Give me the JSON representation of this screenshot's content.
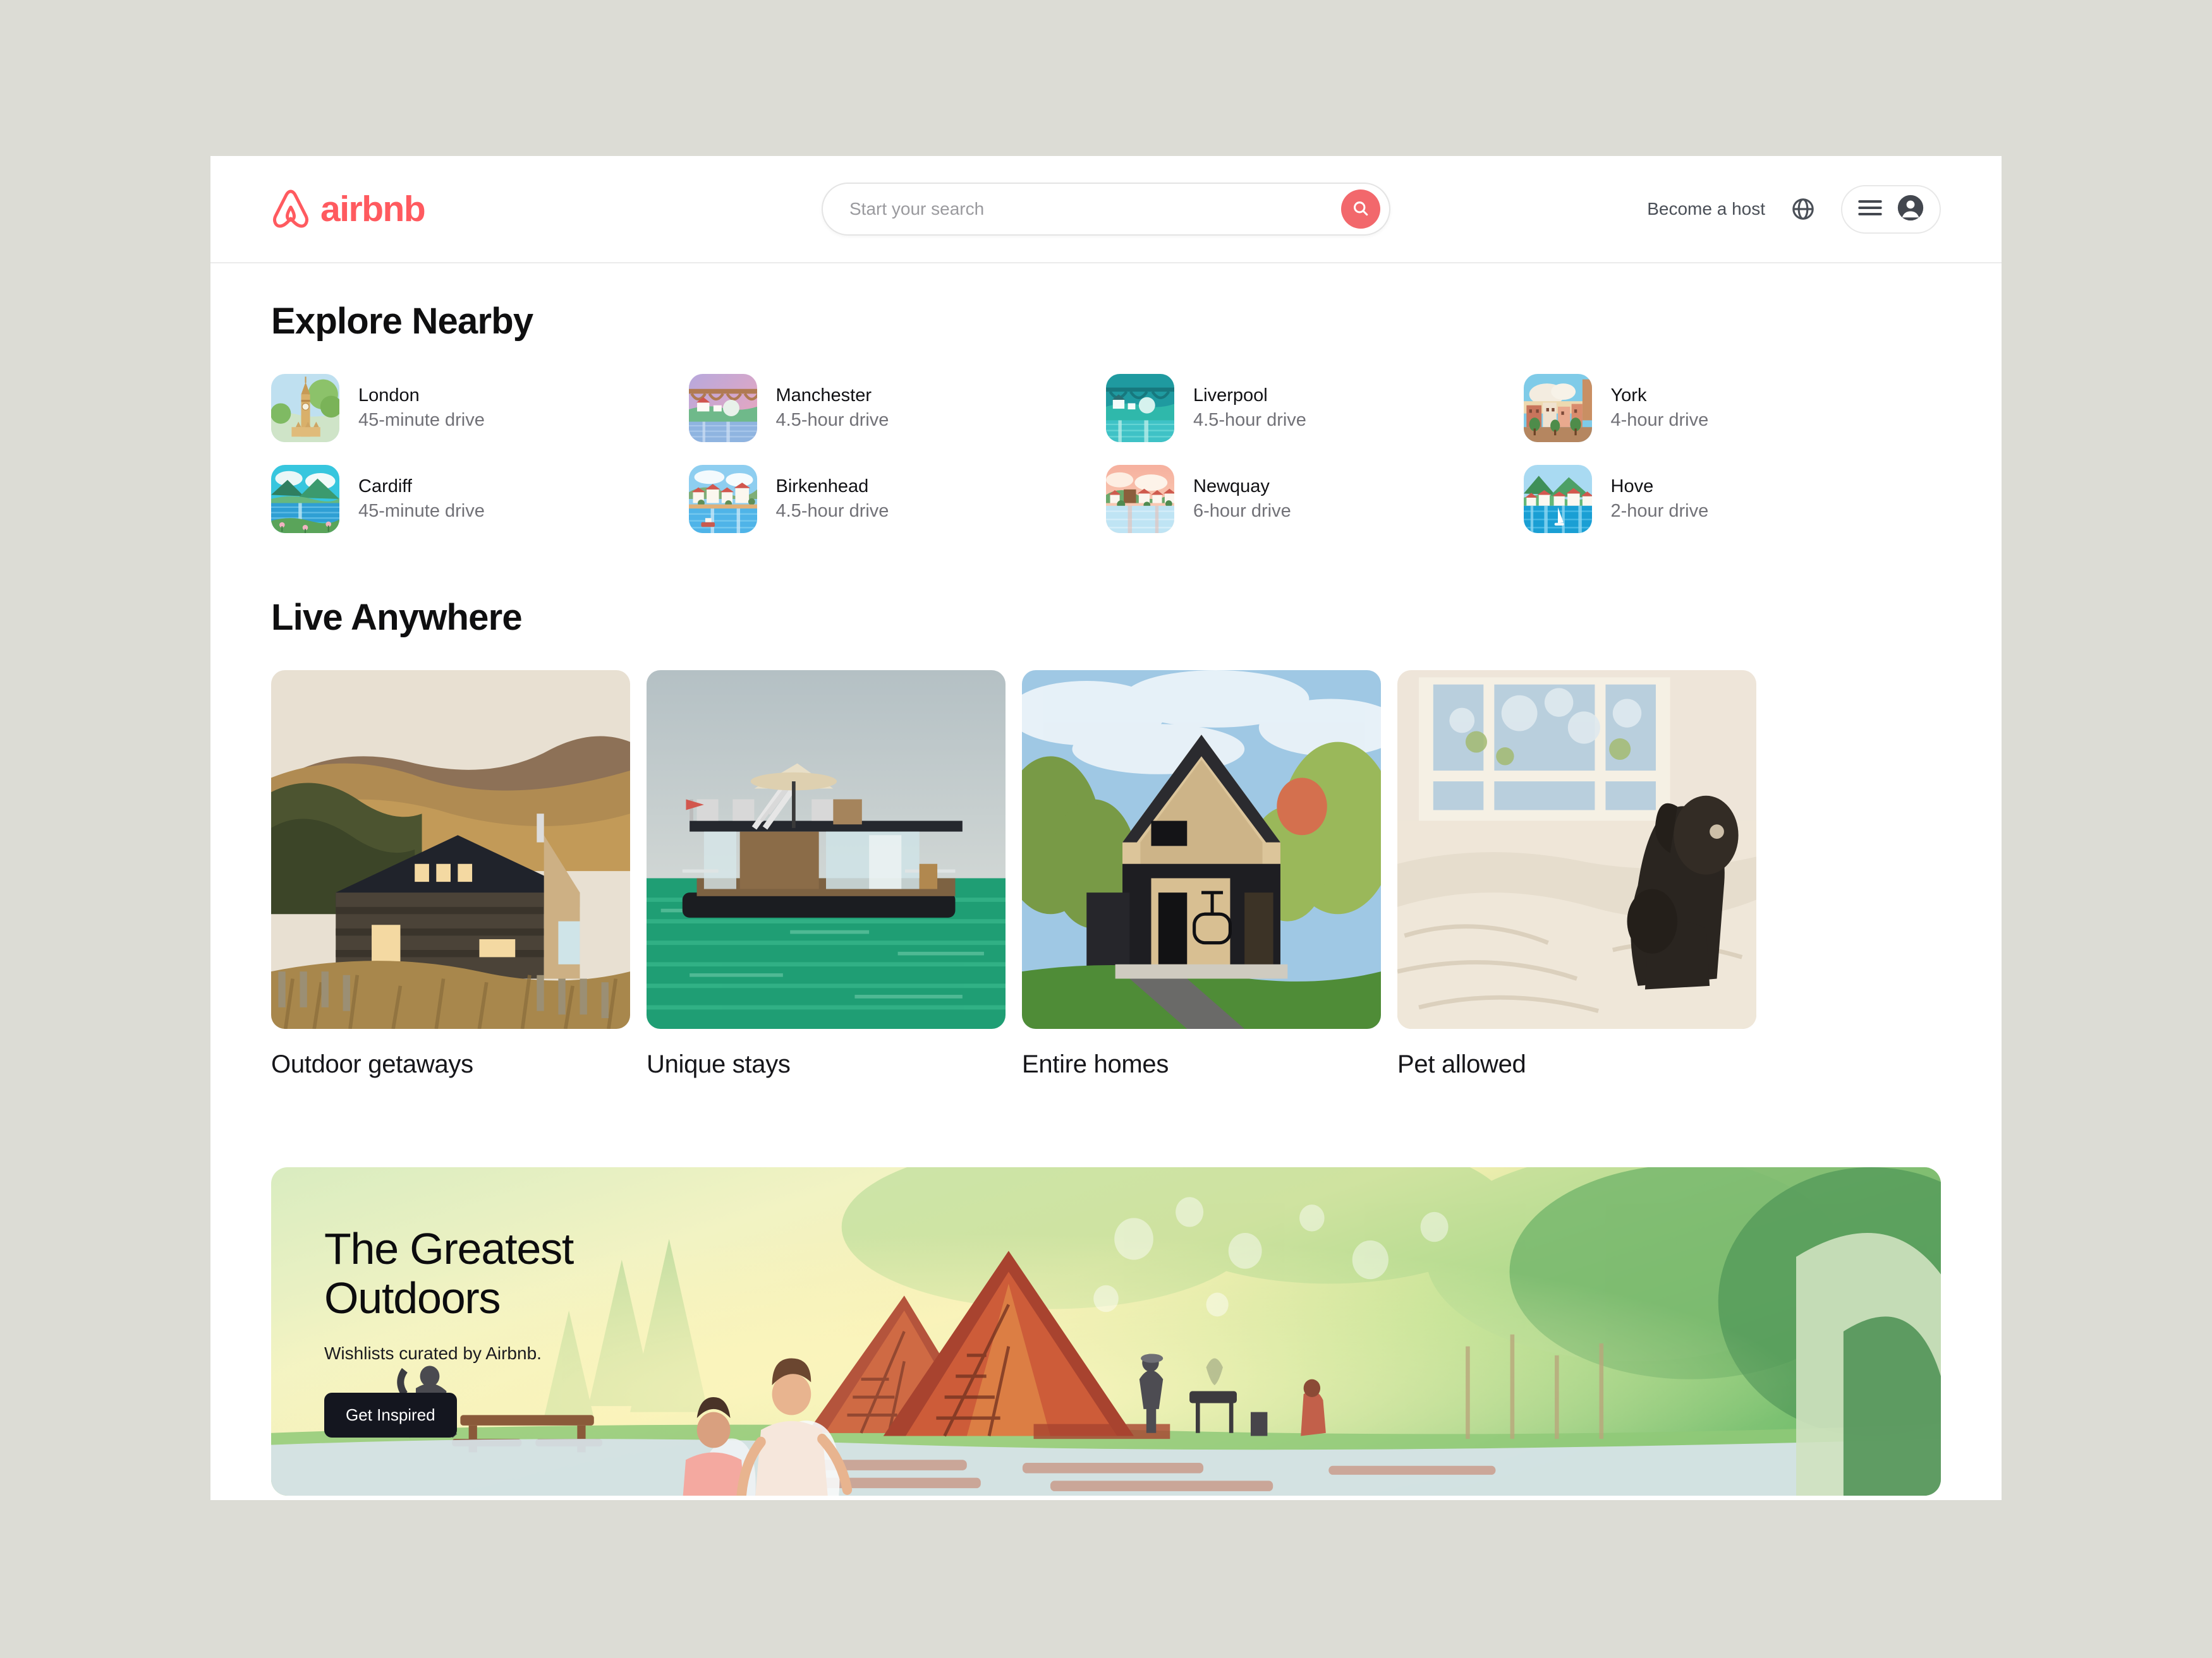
{
  "brand": {
    "name": "airbnb",
    "accent_color": "#FF5A5F",
    "logo_icon": "airbnb-belo-icon"
  },
  "header": {
    "search": {
      "placeholder": "Start your search",
      "value": "",
      "button_icon": "search-icon",
      "button_color": "#F2686C"
    },
    "become_host_label": "Become a host",
    "globe_icon": "globe-icon",
    "menu_icon": "hamburger-menu-icon",
    "avatar_icon": "user-avatar-icon"
  },
  "explore": {
    "title": "Explore Nearby",
    "destinations": [
      {
        "name": "London",
        "drive": "45-minute drive",
        "thumb": "big-ben-illustration"
      },
      {
        "name": "Manchester",
        "drive": "4.5-hour drive",
        "thumb": "viaduct-bridge-illustration"
      },
      {
        "name": "Liverpool",
        "drive": "4.5-hour drive",
        "thumb": "teal-bridge-illustration"
      },
      {
        "name": "York",
        "drive": "4-hour drive",
        "thumb": "old-town-square-illustration"
      },
      {
        "name": "Cardiff",
        "drive": "45-minute drive",
        "thumb": "lake-valley-illustration"
      },
      {
        "name": "Birkenhead",
        "drive": "4.5-hour drive",
        "thumb": "harbour-town-illustration"
      },
      {
        "name": "Newquay",
        "drive": "6-hour drive",
        "thumb": "coastal-sunset-illustration"
      },
      {
        "name": "Hove",
        "drive": "2-hour drive",
        "thumb": "seaside-village-illustration"
      }
    ]
  },
  "live_anywhere": {
    "title": "Live Anywhere",
    "categories": [
      {
        "label": "Outdoor getaways",
        "photo": "cabin-in-golden-hills-photo"
      },
      {
        "label": "Unique stays",
        "photo": "floating-houseboat-photo"
      },
      {
        "label": "Entire homes",
        "photo": "modern-wood-gable-house-photo"
      },
      {
        "label": "Pet allowed",
        "photo": "dog-on-bed-photo"
      }
    ]
  },
  "promo": {
    "title": "The Greatest\nOutdoors",
    "subtitle": "Wishlists curated by Airbnb.",
    "cta_label": "Get Inspired",
    "cta_color": "#14161f",
    "art": "watercolor-campsite-illustration"
  }
}
